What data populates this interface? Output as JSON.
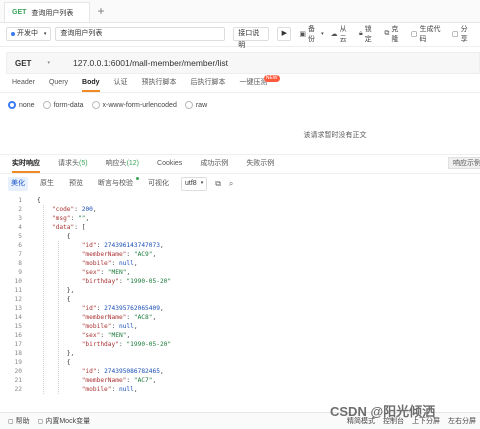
{
  "tab": {
    "method": "GET",
    "title": "查询用户列表",
    "add": "+"
  },
  "toolbar": {
    "env": "开发中",
    "name_value": "查询用户列表",
    "doc_button": "接口说明",
    "run_button": "",
    "buttons": [
      "备份",
      "从云",
      "锁定",
      "克隆",
      "生成代码",
      "分享"
    ]
  },
  "url": {
    "method": "GET",
    "value": "127.0.0.1:6001/mall-member/member/list"
  },
  "request_tabs": [
    {
      "label": "Header",
      "active": false
    },
    {
      "label": "Query",
      "active": false
    },
    {
      "label": "Body",
      "active": true
    },
    {
      "label": "认证",
      "active": false
    },
    {
      "label": "预执行脚本",
      "active": false
    },
    {
      "label": "后执行脚本",
      "active": false
    },
    {
      "label": "一键压测",
      "active": false,
      "badge": "NEW"
    }
  ],
  "body_types": [
    {
      "label": "none",
      "selected": true
    },
    {
      "label": "form-data",
      "selected": false
    },
    {
      "label": "x-www-form-urlencoded",
      "selected": false
    },
    {
      "label": "raw",
      "selected": false
    }
  ],
  "no_body_text": "该请求暂时没有正文",
  "response_tabs": [
    {
      "label": "实时响应",
      "count": "",
      "active": true
    },
    {
      "label": "请求头",
      "count": "(5)",
      "active": false
    },
    {
      "label": "响应头",
      "count": "(12)",
      "active": false
    },
    {
      "label": "Cookies",
      "count": "",
      "active": false
    },
    {
      "label": "成功示例",
      "count": "",
      "active": false
    },
    {
      "label": "失败示例",
      "count": "",
      "active": false
    }
  ],
  "response_example_btn": "响应示例",
  "view_tabs": [
    {
      "label": "美化",
      "active": true
    },
    {
      "label": "原生",
      "active": false
    },
    {
      "label": "预览",
      "active": false
    },
    {
      "label": "断言与校验",
      "active": false
    },
    {
      "label": "可视化",
      "active": false
    }
  ],
  "encoding": "utf8",
  "code_lines": [
    {
      "n": "1",
      "t": "{"
    },
    {
      "n": "2",
      "t": "    \"code\": 200,"
    },
    {
      "n": "3",
      "t": "    \"msg\": \"\","
    },
    {
      "n": "4",
      "t": "    \"data\": ["
    },
    {
      "n": "5",
      "t": "        {"
    },
    {
      "n": "6",
      "t": "            \"id\": 274396143747073,"
    },
    {
      "n": "7",
      "t": "            \"memberName\": \"AC9\","
    },
    {
      "n": "8",
      "t": "            \"mobile\": null,"
    },
    {
      "n": "9",
      "t": "            \"sex\": \"MEN\","
    },
    {
      "n": "10",
      "t": "            \"birthday\": \"1990-05-20\""
    },
    {
      "n": "11",
      "t": "        },"
    },
    {
      "n": "12",
      "t": "        {"
    },
    {
      "n": "13",
      "t": "            \"id\": 274395762065409,"
    },
    {
      "n": "14",
      "t": "            \"memberName\": \"AC8\","
    },
    {
      "n": "15",
      "t": "            \"mobile\": null,"
    },
    {
      "n": "16",
      "t": "            \"sex\": \"MEN\","
    },
    {
      "n": "17",
      "t": "            \"birthday\": \"1990-05-20\""
    },
    {
      "n": "18",
      "t": "        },"
    },
    {
      "n": "19",
      "t": "        {"
    },
    {
      "n": "20",
      "t": "            \"id\": 274395086782465,"
    },
    {
      "n": "21",
      "t": "            \"memberName\": \"AC7\","
    },
    {
      "n": "22",
      "t": "            \"mobile\": null,"
    }
  ],
  "bottom": {
    "help": "帮助",
    "mock": "内置Mock变量",
    "right": [
      "精简模式",
      "控制台",
      "上下分屏",
      "左右分屏"
    ]
  },
  "watermark": "CSDN @阳光倾洒",
  "colors": {
    "accent": "#f08a24",
    "get": "#3aa55a",
    "link": "#1a56c8"
  }
}
